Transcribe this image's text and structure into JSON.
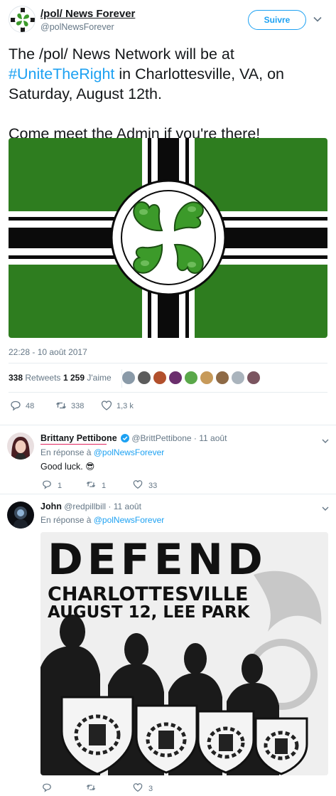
{
  "main_tweet": {
    "display_name": "/pol/ News Forever",
    "handle": "@polNewsForever",
    "follow_label": "Suivre",
    "text_line1": "The /pol/ News Network will be at",
    "hashtag": "#UniteTheRight",
    "text_line2_rest": " in Charlottesville, VA, on",
    "text_line3": "Saturday, August 12th.",
    "text_line4": "Come meet the Admin if you're there!",
    "timestamp": "22:28 - 10 août 2017",
    "retweets_count": "338",
    "retweets_label": "Retweets",
    "likes_count": "1 259",
    "likes_label": "J'aime",
    "actions": {
      "replies": "48",
      "retweets": "338",
      "likes": "1,3 k"
    },
    "colors": {
      "flag_green": "#2e7d1f",
      "accent": "#1da1f2"
    }
  },
  "replies": [
    {
      "display_name": "Brittany Pettibone",
      "handle": "@BrittPettibone",
      "date": "· 11 août",
      "in_reply_prefix": "En réponse à ",
      "in_reply_mention": "@polNewsForever",
      "text": "Good luck. 😎",
      "actions": {
        "replies": "1",
        "retweets": "1",
        "likes": "33"
      }
    },
    {
      "display_name": "John",
      "handle": "@redpillbill",
      "date": "· 11 août",
      "in_reply_prefix": "En réponse à ",
      "in_reply_mention": "@polNewsForever",
      "poster": {
        "line1": "DEFEND",
        "line2": "CHARLOTTESVILLE",
        "line3": "AUGUST 12, LEE PARK"
      },
      "actions": {
        "replies": "",
        "retweets": "",
        "likes": "3"
      }
    }
  ],
  "icons": [
    "clover-logo-icon",
    "chevron-down-icon",
    "reply-icon",
    "retweet-icon",
    "heart-icon",
    "verified-badge-icon"
  ]
}
